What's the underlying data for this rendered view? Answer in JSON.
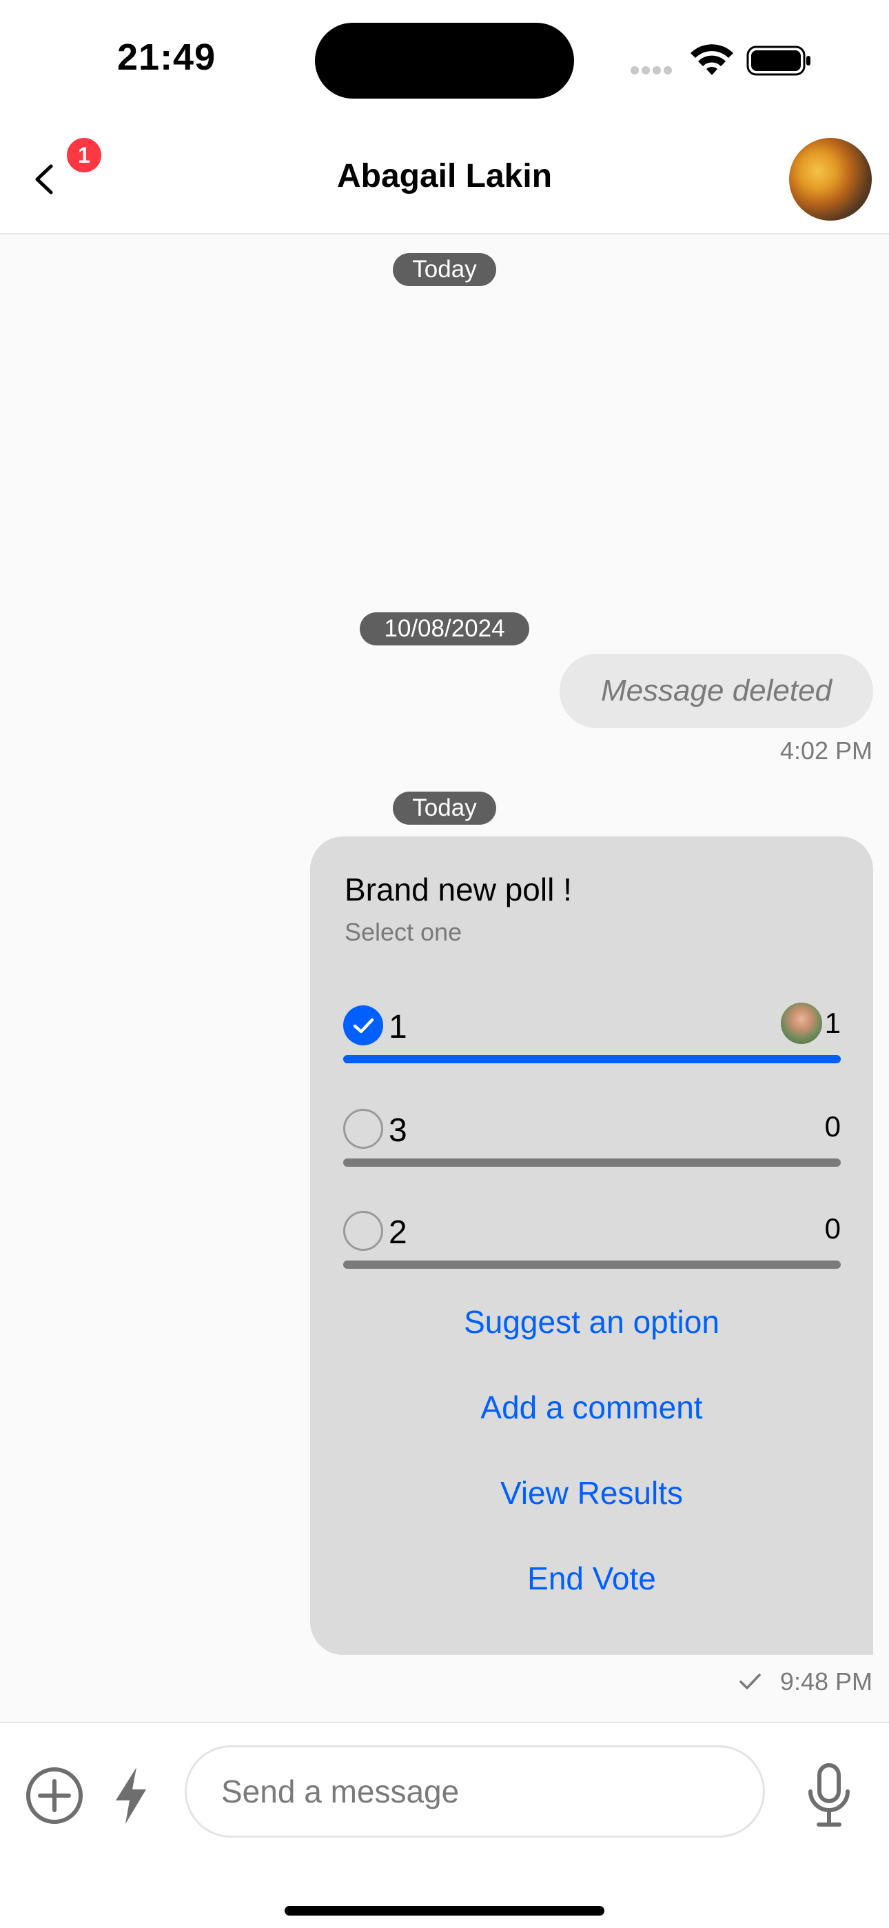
{
  "status_bar": {
    "time": "21:49"
  },
  "header": {
    "title": "Abagail Lakin",
    "unread_badge": "1"
  },
  "dates": {
    "first": "Today",
    "second": "10/08/2024",
    "third": "Today"
  },
  "deleted_message": {
    "text": "Message deleted",
    "time": "4:02 PM"
  },
  "poll": {
    "title": "Brand new poll !",
    "subtitle": "Select one",
    "options": [
      {
        "label": "1",
        "count": "1",
        "selected": true,
        "fill_percent": 100
      },
      {
        "label": "3",
        "count": "0",
        "selected": false,
        "fill_percent": 0
      },
      {
        "label": "2",
        "count": "0",
        "selected": false,
        "fill_percent": 0
      }
    ],
    "actions": [
      "Suggest an option",
      "Add a comment",
      "View Results",
      "End Vote"
    ],
    "time": "9:48 PM"
  },
  "composer": {
    "placeholder": "Send a message"
  },
  "colors": {
    "accent": "#005fff",
    "badge": "#ff3742",
    "bubble": "#dbdbdb"
  }
}
